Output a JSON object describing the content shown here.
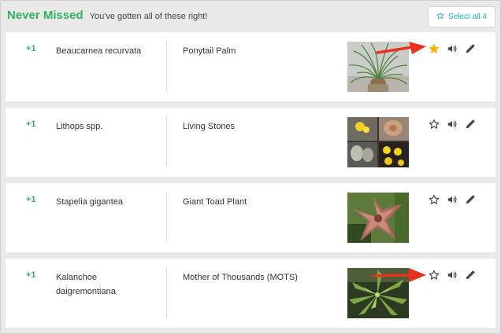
{
  "header": {
    "title": "Never Missed",
    "subtitle": "You've gotten all of these right!",
    "select_all_label": "Select all 4"
  },
  "colors": {
    "accent_green": "#2eb35e",
    "accent_teal": "#1eb5bd",
    "star_active": "#f5b50a",
    "arrow_red": "#e8321e"
  },
  "items": [
    {
      "points": "+1",
      "scientific_name": "Beaucarnea recurvata",
      "common_name": "Ponytail Palm",
      "starred": true,
      "image_icon": "ponytail-palm-photo"
    },
    {
      "points": "+1",
      "scientific_name": "Lithops spp.",
      "common_name": "Living Stones",
      "starred": false,
      "image_icon": "living-stones-photo"
    },
    {
      "points": "+1",
      "scientific_name": "Stapelia gigantea",
      "common_name": "Giant Toad Plant",
      "starred": false,
      "image_icon": "giant-toad-plant-photo"
    },
    {
      "points": "+1",
      "scientific_name": "Kalanchoe daigremontiana",
      "common_name": "Mother of Thousands (MOTS)",
      "starred": false,
      "image_icon": "mother-of-thousands-photo"
    }
  ]
}
